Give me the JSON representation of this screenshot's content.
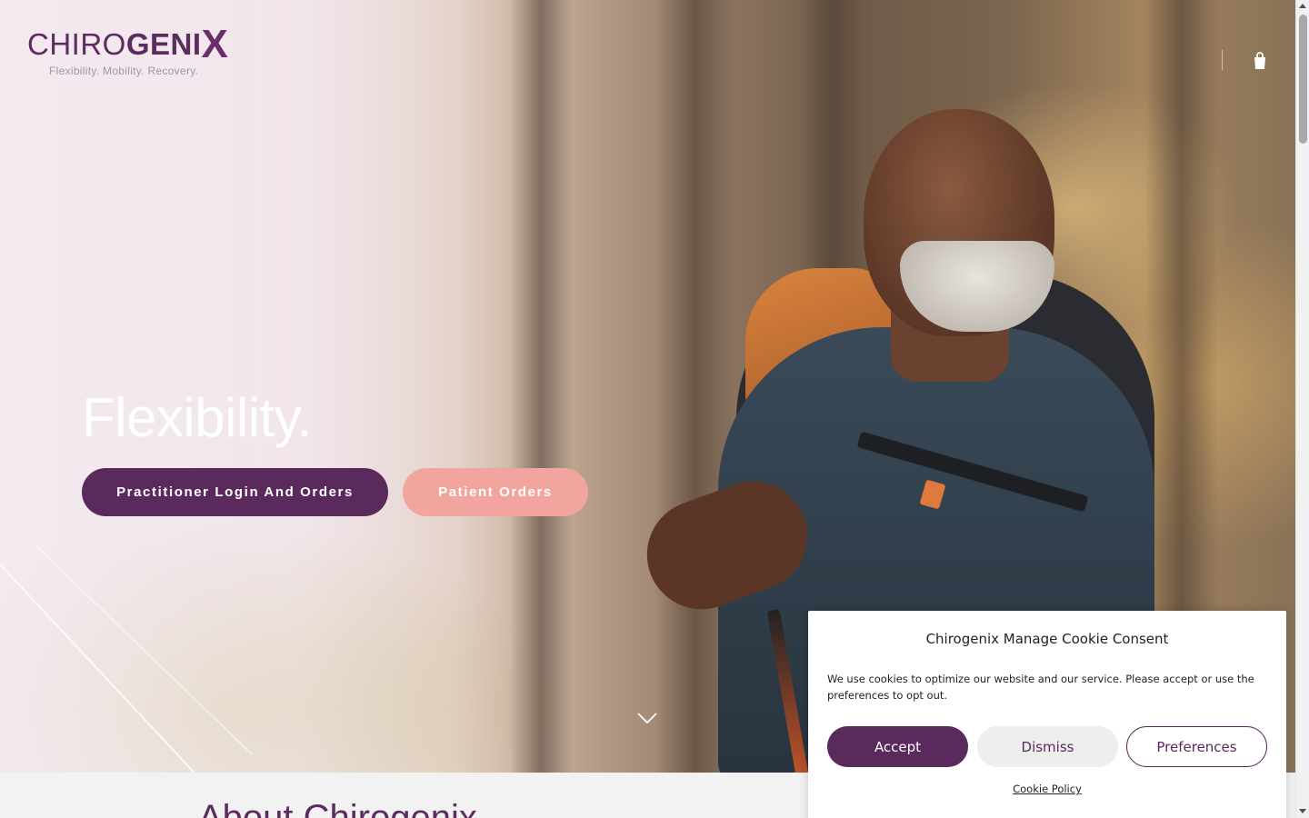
{
  "header": {
    "logo_light": "CHIRO",
    "logo_bold": "GENI",
    "logo_x": "X",
    "tagline": "Flexibility. Mobility. Recovery.",
    "cart_icon": "shopping-bag-icon"
  },
  "hero": {
    "title": "Flexibility.",
    "practitioner_button": "Practitioner Login And Orders",
    "patient_button": "Patient Orders",
    "scroll_icon": "chevron-down-icon"
  },
  "about": {
    "title": "About Chirogenix"
  },
  "cookie": {
    "title": "Chirogenix Manage Cookie Consent",
    "body": "We use cookies to optimize our website and our service. Please accept or use the preferences to opt out.",
    "accept": "Accept",
    "dismiss": "Dismiss",
    "preferences": "Preferences",
    "policy_link": "Cookie Policy"
  },
  "colors": {
    "brand_purple": "#5a2a5c",
    "accent_pink": "#f2a59e"
  }
}
